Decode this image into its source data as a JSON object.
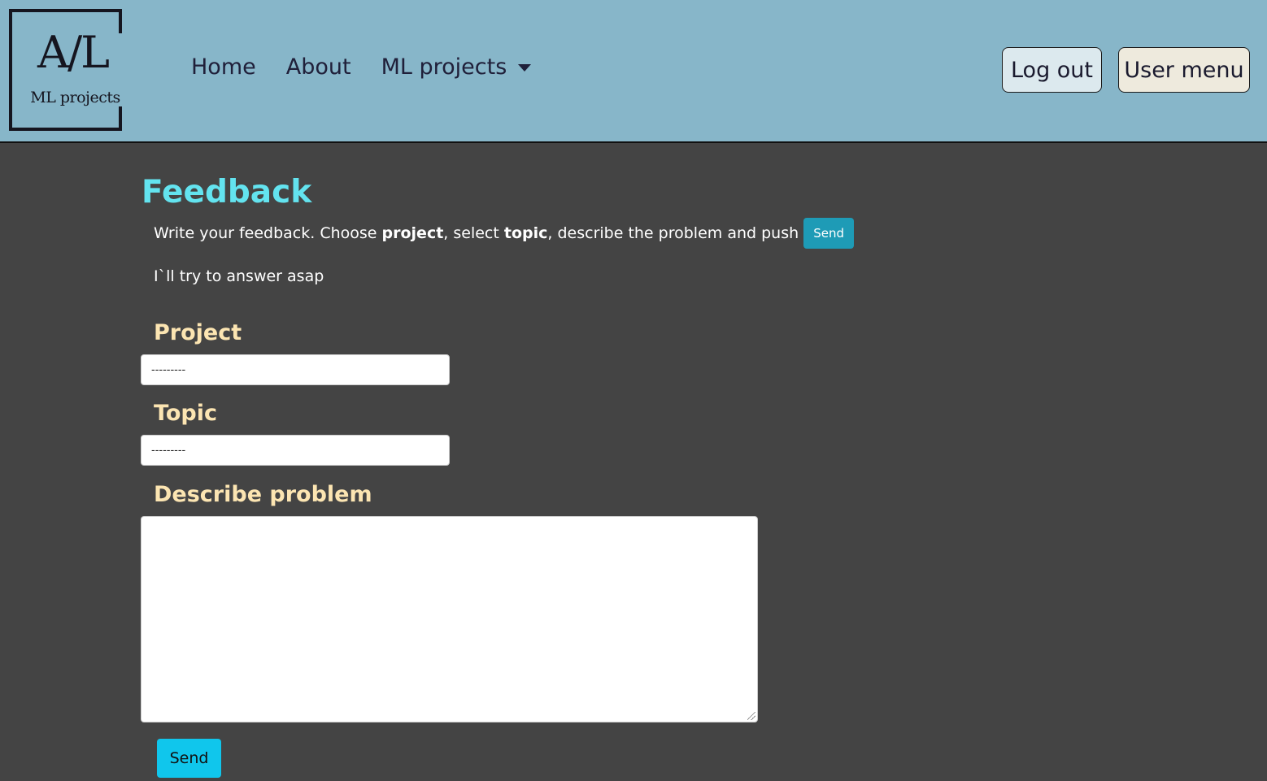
{
  "navbar": {
    "logo": {
      "main": "A/L",
      "sub": "ML projects"
    },
    "links": [
      {
        "label": "Home"
      },
      {
        "label": "About"
      },
      {
        "label": "ML projects"
      }
    ],
    "logout_label": "Log out",
    "user_menu_label": "User menu",
    "background_color": "#87b6c9"
  },
  "page": {
    "title": "Feedback",
    "intro": {
      "part1": "Write your feedback. Choose ",
      "bold1": "project",
      "part2": ", select ",
      "bold2": "topic",
      "part3": ", describe the problem and push",
      "send_label": "Send"
    },
    "reply_note": "I`ll try to answer asap",
    "title_color": "#63e3ef",
    "label_color": "#fce5b2"
  },
  "form": {
    "project": {
      "label": "Project",
      "value": "---------"
    },
    "topic": {
      "label": "Topic",
      "value": "---------"
    },
    "problem": {
      "label": "Describe problem",
      "value": ""
    },
    "send_label": "Send",
    "send_color": "#10c6ec"
  }
}
